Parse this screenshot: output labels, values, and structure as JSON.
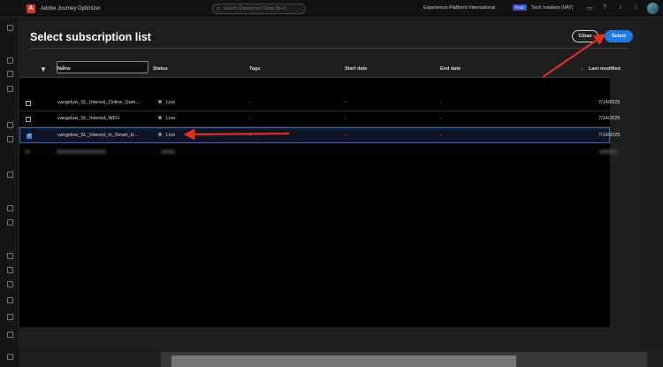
{
  "topbar": {
    "app_title": "Adobe Journey Optimizer",
    "search_placeholder": "Search Experience Cloud (⌘+/)",
    "org_name": "Experience Platform International",
    "sandbox_badge": "Prod",
    "sandbox_name": "Tech Insiders (VAT)"
  },
  "modal": {
    "title": "Select subscription list",
    "close_label": "Close",
    "select_label": "Select",
    "filter_value": "",
    "columns": {
      "name": "Name",
      "status": "Status",
      "tags": "Tags",
      "start_date": "Start date",
      "end_date": "End date",
      "last_modified": "Last modified"
    },
    "sort_indicator": "↓",
    "rows": [
      {
        "name": "vangeluw_SL_Interest_Online_Gam...",
        "status": "Live",
        "tags": "-",
        "start_date": "-",
        "end_date": "-",
        "last_modified": "7/14/2025",
        "selected": false
      },
      {
        "name": "vangeluw_SL_Interest_WFH",
        "status": "Live",
        "tags": "-",
        "start_date": "-",
        "end_date": "-",
        "last_modified": "7/14/2025",
        "selected": false
      },
      {
        "name": "vangeluw_SL_Interest_in_Smart_H...",
        "status": "Live",
        "tags": "-",
        "start_date": "-",
        "end_date": "-",
        "last_modified": "7/14/2025",
        "selected": true
      }
    ]
  },
  "colors": {
    "accent": "#1f7ae0",
    "live_status": "#3fb47c",
    "annotation_arrow": "#e0301e",
    "selected_border": "#3b6ab5"
  }
}
